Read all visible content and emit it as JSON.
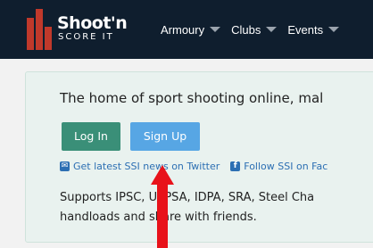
{
  "navbar": {
    "logo_top": "Shoot'n",
    "logo_bottom": "SCORE IT",
    "menu": [
      {
        "label": "Armoury"
      },
      {
        "label": "Clubs"
      },
      {
        "label": "Events"
      }
    ]
  },
  "main": {
    "headline": "The home of sport shooting online, mal",
    "login_label": "Log In",
    "signup_label": "Sign Up",
    "twitter_link": "Get latest SSI news on Twitter",
    "facebook_link": "Follow SSI on Fac",
    "support_line1": "Supports IPSC, USPSA, IDPA, SRA, Steel Cha",
    "support_line2": "handloads and share with friends."
  },
  "colors": {
    "navbar_bg": "#0f1e2e",
    "logo_red": "#c0392b",
    "login_green": "#3a8f78",
    "signup_blue": "#57a6e4",
    "link_blue": "#2c6fb3",
    "panel_bg": "#e9f2ef",
    "arrow_red": "#e8121a"
  },
  "icons": {
    "twitter": "twitter-icon",
    "facebook": "facebook-icon",
    "caret": "caret-down-icon",
    "annotation": "red-arrow-icon"
  }
}
